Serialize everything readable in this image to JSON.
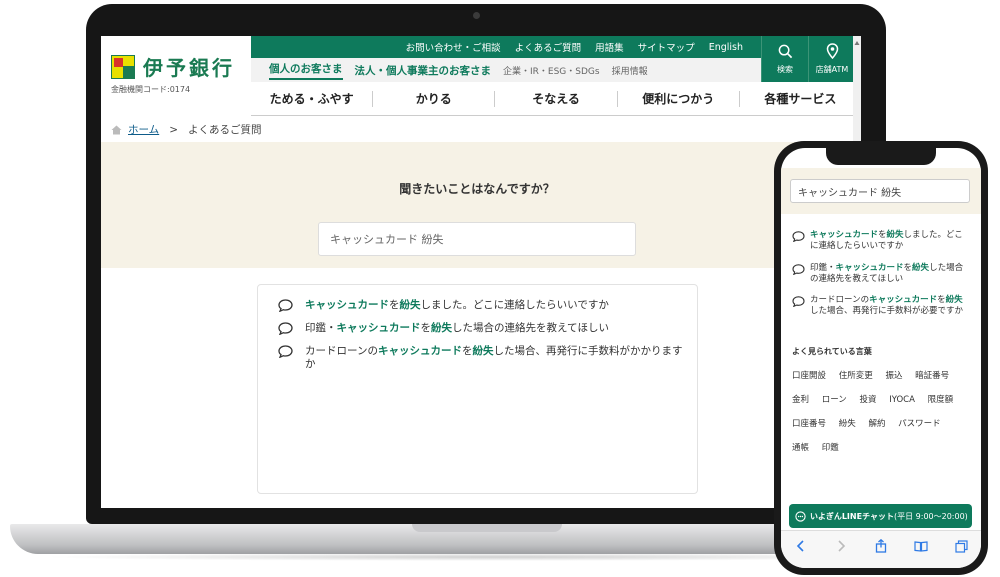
{
  "desktop": {
    "logo_text": "伊予銀行",
    "bank_code": "金融機関コード:0174",
    "top_links": [
      "お問い合わせ・ご相談",
      "よくあるご質問",
      "用語集",
      "サイトマップ",
      "English"
    ],
    "sub_tabs": {
      "personal": "個人のお客さま",
      "corporate": "法人・個人事業主のお客さま",
      "company": "企業・IR・ESG・SDGs",
      "recruit": "採用情報"
    },
    "tools": {
      "search": "検索",
      "atm": "店舗ATM"
    },
    "nav": [
      "ためる・ふやす",
      "かりる",
      "そなえる",
      "便利につかう",
      "各種サービス"
    ],
    "breadcrumb": {
      "home": "ホーム",
      "separator": ">",
      "current": "よくあるご質問"
    },
    "hero": {
      "question": "聞きたいことはなんですか？",
      "search_value": "キャッシュカード 紛失"
    },
    "faqs": [
      {
        "p1": "",
        "h1": "キャッシュカード",
        "p2": "を",
        "h2": "紛失",
        "p3": "しました。どこに連絡したらいいですか"
      },
      {
        "p1": "印鑑・",
        "h1": "キャッシュカード",
        "p2": "を",
        "h2": "紛失",
        "p3": "した場合の連絡先を教えてほしい"
      },
      {
        "p1": "カードローンの",
        "h1": "キャッシュカード",
        "p2": "を",
        "h2": "紛失",
        "p3": "した場合、再発行に手数料がかかりますか"
      }
    ]
  },
  "mobile": {
    "search_value": "キャッシュカード 紛失",
    "faqs": [
      {
        "p1": "",
        "h1": "キャッシュカード",
        "p2": "を",
        "h2": "紛失",
        "p3": "しました。どこに連絡したらいいですか"
      },
      {
        "p1": "印鑑・",
        "h1": "キャッシュカード",
        "p2": "を",
        "h2": "紛失",
        "p3": "した場合の連絡先を教えてほしい"
      },
      {
        "p1": "カードローンの",
        "h1": "キャッシュカード",
        "p2": "を",
        "h2": "紛失",
        "p3": "した場合、再発行に手数料が必要ですか"
      }
    ],
    "popular_title": "よく見られている言葉",
    "popular_words": [
      "口座開設",
      "住所変更",
      "振込",
      "暗証番号",
      "金利",
      "ローン",
      "投資",
      "IYOCA",
      "限度額",
      "口座番号",
      "紛失",
      "解約",
      "パスワード",
      "通帳",
      "印鑑"
    ],
    "chat": {
      "label": "いよぎんLINEチャット",
      "hours": "(平日 9:00〜20:00)"
    }
  },
  "colors": {
    "brand_green": "#0e7a5c",
    "hero_bg": "#f6f2e6"
  },
  "icons": [
    "search-icon",
    "map-pin-icon",
    "home-icon",
    "chat-bubble-icon",
    "chevron-left-icon",
    "chevron-right-icon",
    "share-icon",
    "book-icon",
    "tabs-icon"
  ]
}
